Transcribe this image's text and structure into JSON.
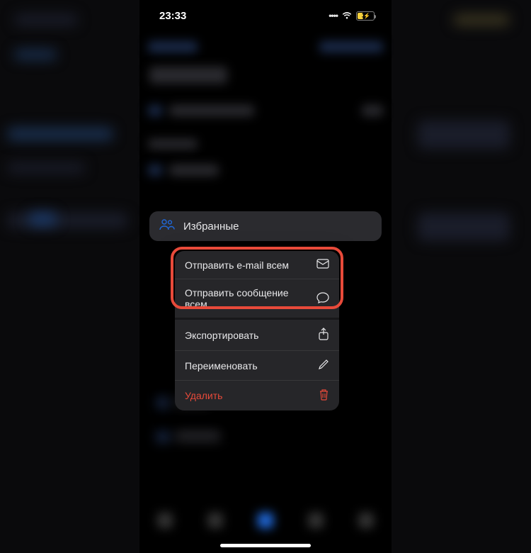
{
  "status": {
    "time": "23:33",
    "battery_percent": "36"
  },
  "favorites": {
    "label": "Избранные"
  },
  "menu": {
    "email_all": "Отправить e-mail всем",
    "message_all": "Отправить сообщение всем",
    "export": "Экспортировать",
    "rename": "Переименовать",
    "delete": "Удалить"
  },
  "colors": {
    "accent": "#2068d8",
    "danger": "#e84a3a",
    "highlight": "#e84a3a"
  }
}
